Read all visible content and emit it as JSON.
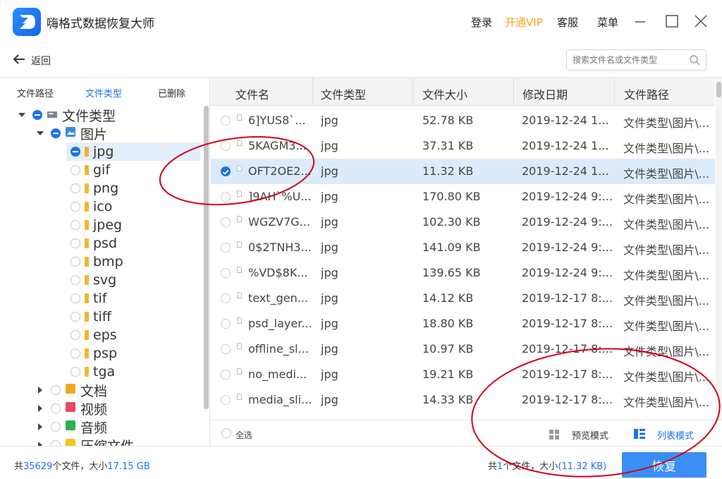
{
  "app": {
    "title": "嗨格式数据恢复大师",
    "login": "登录",
    "vip": "开通VIP",
    "service": "客服",
    "menu": "菜单"
  },
  "toolbar": {
    "back_label": "返回",
    "search_placeholder": "搜索文件名或文件类型"
  },
  "left_tabs": [
    "文件路径",
    "文件类型",
    "已删除"
  ],
  "tree": {
    "root": "文件类型",
    "images": "图片",
    "image_types": [
      "jpg",
      "gif",
      "png",
      "ico",
      "jpeg",
      "psd",
      "bmp",
      "svg",
      "tif",
      "tiff",
      "eps",
      "psp",
      "tga"
    ],
    "others": [
      "文档",
      "视频",
      "音频",
      "压缩文件"
    ]
  },
  "table": {
    "headers": [
      "文件名",
      "文件类型",
      "文件大小",
      "修改日期",
      "文件路径"
    ],
    "rows": [
      {
        "name": "6]YUS8`...",
        "type": "jpg",
        "size": "52.78 KB",
        "date": "2019-12-24 1...",
        "path": "文件类型\\图片\\..."
      },
      {
        "name": "5KAGM3...",
        "type": "jpg",
        "size": "37.31 KB",
        "date": "2019-12-24 1...",
        "path": "文件类型\\图片\\..."
      },
      {
        "name": "OFT2OE2...",
        "type": "jpg",
        "size": "11.32 KB",
        "date": "2019-12-24 1...",
        "path": "文件类型\\图片\\..."
      },
      {
        "name": "]9AH`%U...",
        "type": "jpg",
        "size": "170.80 KB",
        "date": "2019-12-24 9:...",
        "path": "文件类型\\图片\\..."
      },
      {
        "name": "WGZV7G...",
        "type": "jpg",
        "size": "102.30 KB",
        "date": "2019-12-24 9:...",
        "path": "文件类型\\图片\\..."
      },
      {
        "name": "0$2TNH3...",
        "type": "jpg",
        "size": "141.09 KB",
        "date": "2019-12-24 9:...",
        "path": "文件类型\\图片\\..."
      },
      {
        "name": "%VD$8K...",
        "type": "jpg",
        "size": "139.65 KB",
        "date": "2019-12-24 9:...",
        "path": "文件类型\\图片\\..."
      },
      {
        "name": "text_gen...",
        "type": "jpg",
        "size": "14.12 KB",
        "date": "2019-12-17 8:...",
        "path": "文件类型\\图片\\..."
      },
      {
        "name": "psd_layer...",
        "type": "jpg",
        "size": "18.80 KB",
        "date": "2019-12-17 8:...",
        "path": "文件类型\\图片\\..."
      },
      {
        "name": "offline_sl...",
        "type": "jpg",
        "size": "10.97 KB",
        "date": "2019-12-17 8:...",
        "path": "文件类型\\图片\\..."
      },
      {
        "name": "no_medi...",
        "type": "jpg",
        "size": "19.21 KB",
        "date": "2019-12-17 8:...",
        "path": "文件类型\\图片\\..."
      },
      {
        "name": "media_sli...",
        "type": "jpg",
        "size": "14.33 KB",
        "date": "2019-12-17 8:...",
        "path": "文件类型\\图片\\..."
      }
    ]
  },
  "bottom": {
    "select_all": "全选",
    "preview_mode": "预览模式",
    "list_mode": "列表模式"
  },
  "status": {
    "prefix": "共",
    "total_files": "35629",
    "mid": "个文件，大小",
    "total_size": "17.15 GB",
    "sel_prefix": "共",
    "sel_count": "1",
    "sel_mid": "个文件，大小",
    "sel_size": "(11.32 KB)",
    "recover": "恢复"
  },
  "colors": {
    "accent": "#1a73e8",
    "vip": "#f5a623",
    "button": "#3a8ef6",
    "annotation": "#d0021b"
  }
}
